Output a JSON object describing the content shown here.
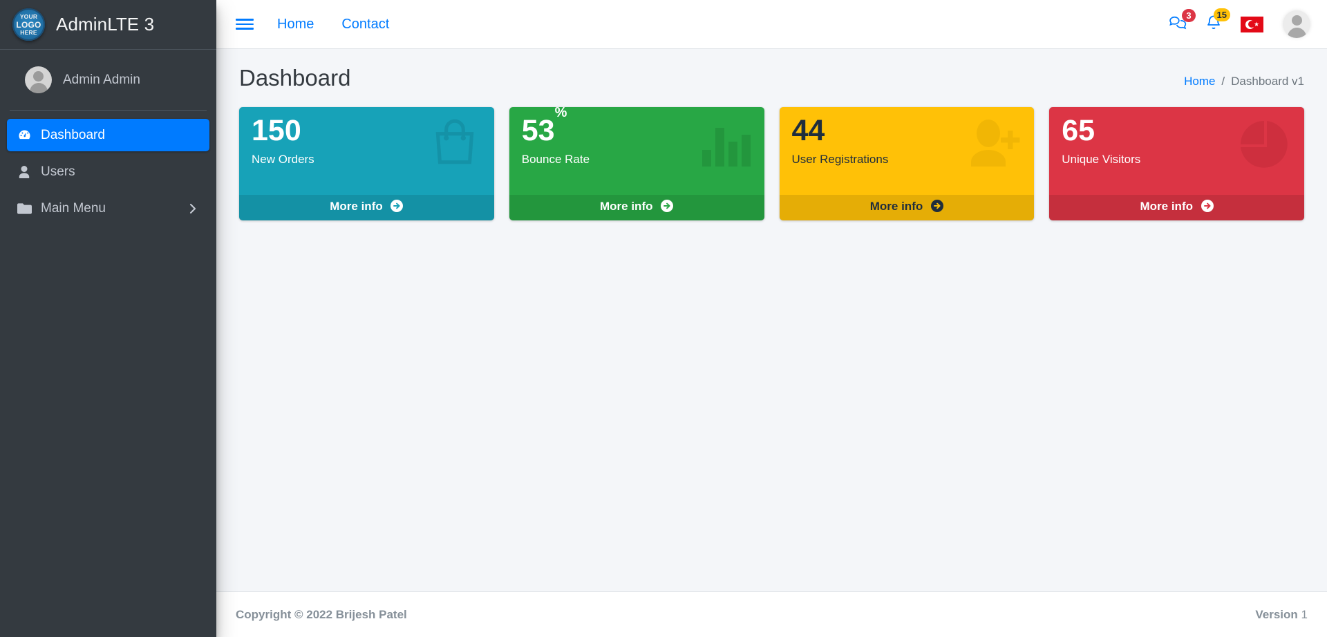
{
  "brand": {
    "logo_line1": "YOUR",
    "logo_line2": "LOGO",
    "logo_line3": "HERE",
    "title": "AdminLTE 3"
  },
  "sidebar": {
    "user": {
      "name": "Admin Admin"
    },
    "items": [
      {
        "label": "Dashboard",
        "icon": "tachometer-icon",
        "active": true,
        "has_arrow": false
      },
      {
        "label": "Users",
        "icon": "user-icon",
        "active": false,
        "has_arrow": false
      },
      {
        "label": "Main Menu",
        "icon": "folder-icon",
        "active": false,
        "has_arrow": true
      }
    ]
  },
  "navbar": {
    "toggle_label": "menu-toggle",
    "links": [
      {
        "label": "Home"
      },
      {
        "label": "Contact"
      }
    ],
    "messages_badge": "3",
    "notifications_badge": "15",
    "language_flag": "turkey-flag",
    "colors": {
      "messages_badge_bg": "#dc3545",
      "notifications_badge_bg": "#ffc107",
      "link": "#007bff"
    }
  },
  "content": {
    "page_title": "Dashboard",
    "breadcrumb": {
      "home": "Home",
      "separator": "/",
      "current": "Dashboard v1"
    },
    "boxes": [
      {
        "value": "150",
        "suffix": "",
        "label": "New Orders",
        "footer": "More info",
        "icon": "shopping-bag-icon",
        "bg": "#17a2b8",
        "text": "light"
      },
      {
        "value": "53",
        "suffix": "%",
        "label": "Bounce Rate",
        "footer": "More info",
        "icon": "bar-chart-icon",
        "bg": "#28a745",
        "text": "light"
      },
      {
        "value": "44",
        "suffix": "",
        "label": "User Registrations",
        "footer": "More info",
        "icon": "user-plus-icon",
        "bg": "#ffc107",
        "text": "dark"
      },
      {
        "value": "65",
        "suffix": "",
        "label": "Unique Visitors",
        "footer": "More info",
        "icon": "pie-chart-icon",
        "bg": "#dc3545",
        "text": "light"
      }
    ]
  },
  "footer": {
    "copyright": "Copyright © 2022 Brijesh Patel",
    "version_label": "Version",
    "version_number": "1"
  }
}
